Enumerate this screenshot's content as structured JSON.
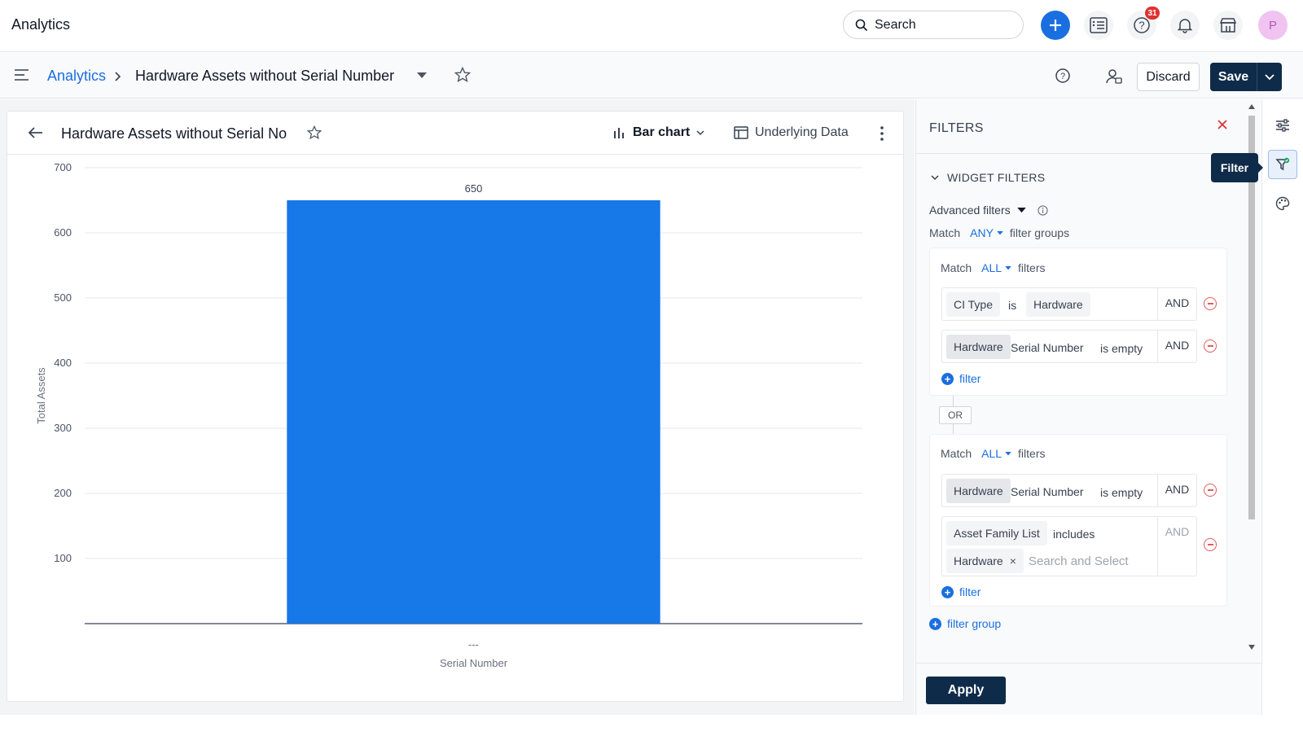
{
  "app": {
    "title": "Analytics"
  },
  "topbar": {
    "search_placeholder": "Search",
    "help_badge": "31",
    "avatar_initial": "P"
  },
  "breadcrumb": {
    "root": "Analytics",
    "current": "Hardware Assets without Serial Number"
  },
  "actions": {
    "discard": "Discard",
    "save": "Save"
  },
  "widget": {
    "title": "Hardware Assets without Serial No",
    "chart_type": "Bar chart",
    "underlying": "Underlying Data"
  },
  "chart_data": {
    "type": "bar",
    "categories": [
      "---"
    ],
    "values": [
      650
    ],
    "data_labels": [
      "650"
    ],
    "xlabel": "Serial Number",
    "ylabel": "Total Assets",
    "ylim": [
      0,
      700
    ],
    "yticks": [
      100,
      200,
      300,
      400,
      500,
      600,
      700
    ],
    "grid": true,
    "bar_color": "#1778e8"
  },
  "filters": {
    "title": "FILTERS",
    "section": "WIDGET FILTERS",
    "advanced": "Advanced filters",
    "match_prefix": "Match",
    "match_any": "ANY",
    "match_groups_suffix": "filter groups",
    "or_label": "OR",
    "add_group": "filter group",
    "apply": "Apply",
    "groups": [
      {
        "match": "ALL",
        "suffix": "filters",
        "add": "filter",
        "conditions": [
          {
            "field": "CI Type",
            "op": "is",
            "value": "Hardware",
            "conj": "AND"
          },
          {
            "prefix": "Hardware",
            "field": "Serial Number",
            "op": "is empty",
            "conj": "AND"
          }
        ]
      },
      {
        "match": "ALL",
        "suffix": "filters",
        "add": "filter",
        "conditions": [
          {
            "prefix": "Hardware",
            "field": "Serial Number",
            "op": "is empty",
            "conj": "AND"
          },
          {
            "field": "Asset Family List",
            "op": "includes",
            "tag": "Hardware",
            "tag_remove": "×",
            "placeholder": "Search and Select",
            "conj": "AND"
          }
        ]
      }
    ]
  },
  "rail": {
    "tooltip": "Filter"
  },
  "colors": {
    "accent": "#1a6fe0",
    "navy": "#0f2b4a",
    "danger": "#e25c5c"
  }
}
